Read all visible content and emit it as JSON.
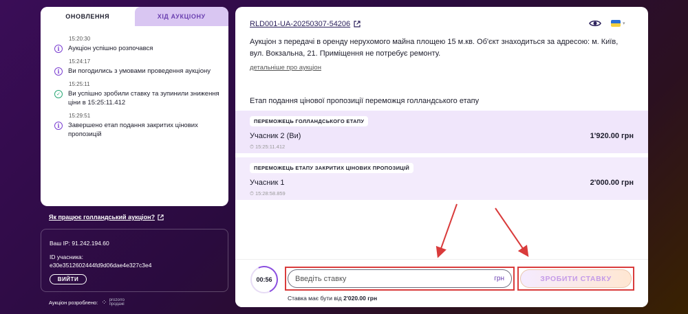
{
  "tabs": {
    "updates": "ОНОВЛЕННЯ",
    "progress": "ХІД АУКЦІОНУ"
  },
  "events": [
    {
      "time": "15:20:30",
      "message": "Аукціон успішно розпочався",
      "icon": "info-icon"
    },
    {
      "time": "15:24:17",
      "message": "Ви погодились з умовами проведення аукціону",
      "icon": "info-icon"
    },
    {
      "time": "15:25:11",
      "message": "Ви успішно зробили ставку та зупинили зниження ціни в 15:25:11.412",
      "icon": "check-icon"
    },
    {
      "time": "15:29:51",
      "message": "Завершено етап подання закритих цінових пропозицій",
      "icon": "info-icon"
    }
  ],
  "how_link": "Як працює голландський аукціон?",
  "info": {
    "ip": "Ваш IP: 91.242.194.60",
    "id_label": "ID учасника:",
    "id_value": "e30e3512602444fd9d06dae4e327c3e4",
    "exit": "ВИЙТИ"
  },
  "developed": {
    "label": "Аукціон розроблено:",
    "brand_1": "prozorro",
    "brand_2": "продажі"
  },
  "auction": {
    "id": "RLD001-UA-20250307-54206",
    "description": "Аукціон з передачі в оренду нерухомого майна площею 15 м.кв. Об'єкт знаходиться за адресою: м. Київ, вул. Вокзальна, 21. Приміщення не потребує ремонту.",
    "more": "детальніше про аукціон",
    "stage_title": "Етап подання цінової пропозиції переможця голландського етапу"
  },
  "winners": [
    {
      "tag": "ПЕРЕМОЖЕЦЬ ГОЛЛАНДСЬКОГО ЕТАПУ",
      "name": "Учасник 2 (Ви)",
      "time": "15:25:11.412",
      "amount": "1'920.00 грн"
    },
    {
      "tag": "ПЕРЕМОЖЕЦЬ ЕТАПУ ЗАКРИТИХ ЦІНОВИХ ПРОПОЗИЦІЙ",
      "name": "Учасник 1",
      "time": "15:28:58.859",
      "amount": "2'000.00 грн"
    }
  ],
  "bid": {
    "timer": "00:56",
    "placeholder": "Введіть ставку",
    "currency": "грн",
    "button": "ЗРОБИТИ СТАВКУ",
    "hint_prefix": "Ставка має бути від",
    "hint_value": "2'020.00 грн"
  },
  "colors": {
    "accent": "#7b3fd1",
    "highlight_border": "#d93b3b",
    "winner_bg": "#f0e6fb"
  }
}
